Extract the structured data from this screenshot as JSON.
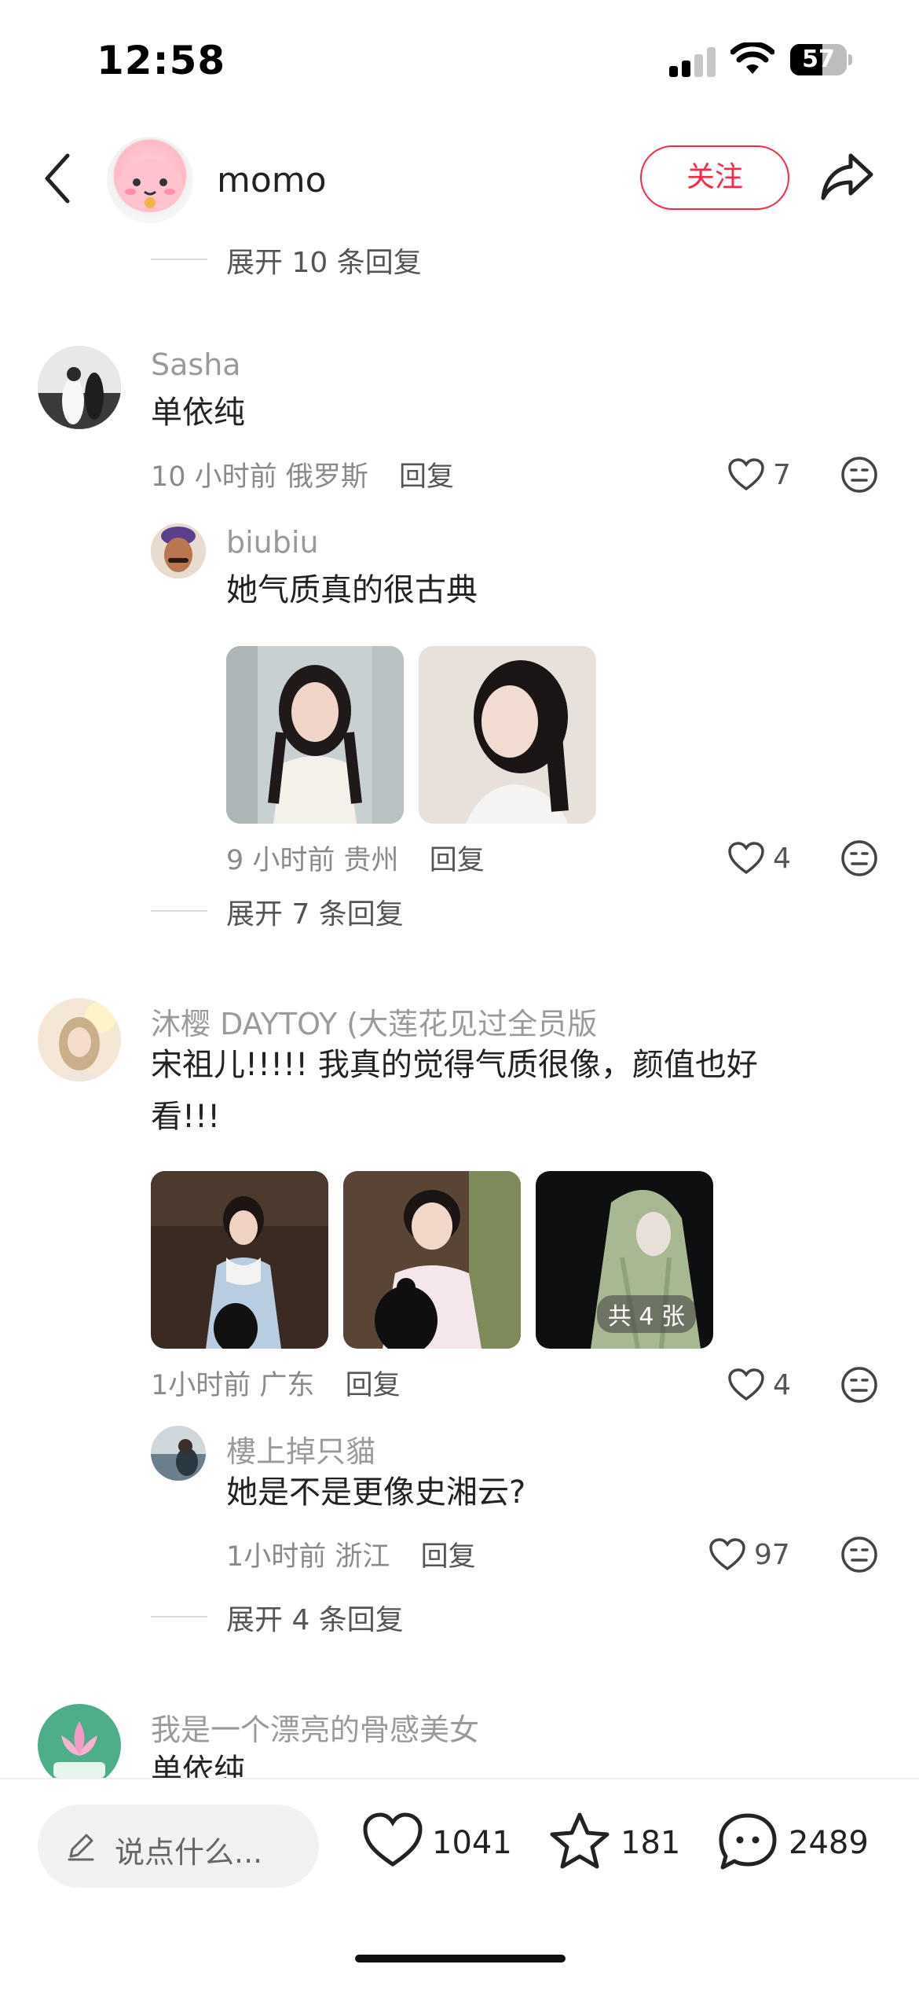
{
  "status_bar": {
    "time": "12:58",
    "battery": "57",
    "battery_level": 0.57
  },
  "header": {
    "username": "momo",
    "follow_label": "关注"
  },
  "colors": {
    "accent": "#ff2741",
    "muted": "#9a9a9a"
  },
  "expand_top": "展开 10 条回复",
  "comments": [
    {
      "name": "Sasha",
      "text": "单依纯",
      "time": "10 小时前",
      "location": "俄罗斯",
      "reply_label": "回复",
      "likes": "7",
      "replies": [
        {
          "name": "biubiu",
          "text": "她气质真的很古典",
          "time": "9 小时前",
          "location": "贵州",
          "reply_label": "回复",
          "likes": "4"
        }
      ],
      "expand_label": "展开 7 条回复"
    },
    {
      "name": "沐樱 DAYTOY (大莲花见过全员版",
      "text_line1": "宋祖儿!!!!!  我真的觉得气质很像，颜值也好",
      "text_line2": "看!!!",
      "photo_count_badge": "共 4 张",
      "time": "1小时前",
      "location": "广东",
      "reply_label": "回复",
      "likes": "4",
      "replies": [
        {
          "name": "樓上掉只貓",
          "text": "她是不是更像史湘云?",
          "time": "1小时前",
          "location": "浙江",
          "reply_label": "回复",
          "likes": "97"
        }
      ],
      "expand_label": "展开 4 条回复"
    },
    {
      "name": "我是一个漂亮的骨感美女",
      "text": "单依纯"
    }
  ],
  "bottom_bar": {
    "input_placeholder": "说点什么...",
    "likes": "1041",
    "stars": "181",
    "comments": "2489"
  }
}
